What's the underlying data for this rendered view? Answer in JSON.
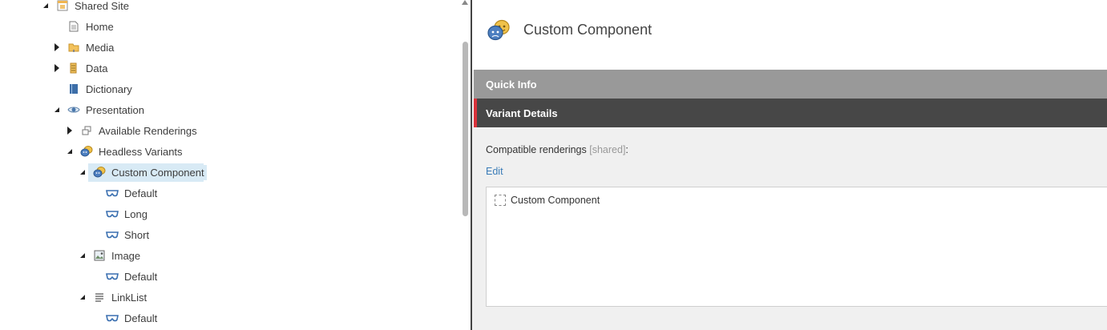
{
  "tree": {
    "items": [
      {
        "label": "Shared Site",
        "state": "expanded",
        "icon": "site-icon"
      },
      {
        "label": "Home",
        "state": "none",
        "icon": "page-icon"
      },
      {
        "label": "Media",
        "state": "collapsed",
        "icon": "folder-icon"
      },
      {
        "label": "Data",
        "state": "collapsed",
        "icon": "data-icon"
      },
      {
        "label": "Dictionary",
        "state": "none",
        "icon": "book-icon"
      },
      {
        "label": "Presentation",
        "state": "expanded",
        "icon": "eye-icon"
      },
      {
        "label": "Available Renderings",
        "state": "collapsed",
        "icon": "renderings-icon"
      },
      {
        "label": "Headless Variants",
        "state": "expanded",
        "icon": "theater-masks-icon"
      },
      {
        "label": "Custom Component",
        "state": "expanded",
        "icon": "theater-masks-icon",
        "selected": true
      },
      {
        "label": "Default",
        "state": "none",
        "icon": "mask-icon"
      },
      {
        "label": "Long",
        "state": "none",
        "icon": "mask-icon"
      },
      {
        "label": "Short",
        "state": "none",
        "icon": "mask-icon"
      },
      {
        "label": "Image",
        "state": "expanded",
        "icon": "image-icon"
      },
      {
        "label": "Default",
        "state": "none",
        "icon": "mask-icon"
      },
      {
        "label": "LinkList",
        "state": "expanded",
        "icon": "list-icon"
      },
      {
        "label": "Default",
        "state": "none",
        "icon": "mask-icon"
      }
    ]
  },
  "editor": {
    "title": "Custom Component",
    "title_icon": "theater-masks-icon",
    "sections": {
      "quick_info": "Quick Info",
      "variant_details": "Variant Details"
    },
    "field": {
      "label": "Compatible renderings",
      "shared_tag": "[shared]",
      "colon": ":",
      "edit_link": "Edit",
      "items": [
        "Custom Component"
      ]
    }
  },
  "colors": {
    "selected_row": "#d8eaf5",
    "quick_info_bar": "#999999",
    "variant_bar": "#474747",
    "accent": "#d9323a",
    "link": "#3a7cb8"
  }
}
